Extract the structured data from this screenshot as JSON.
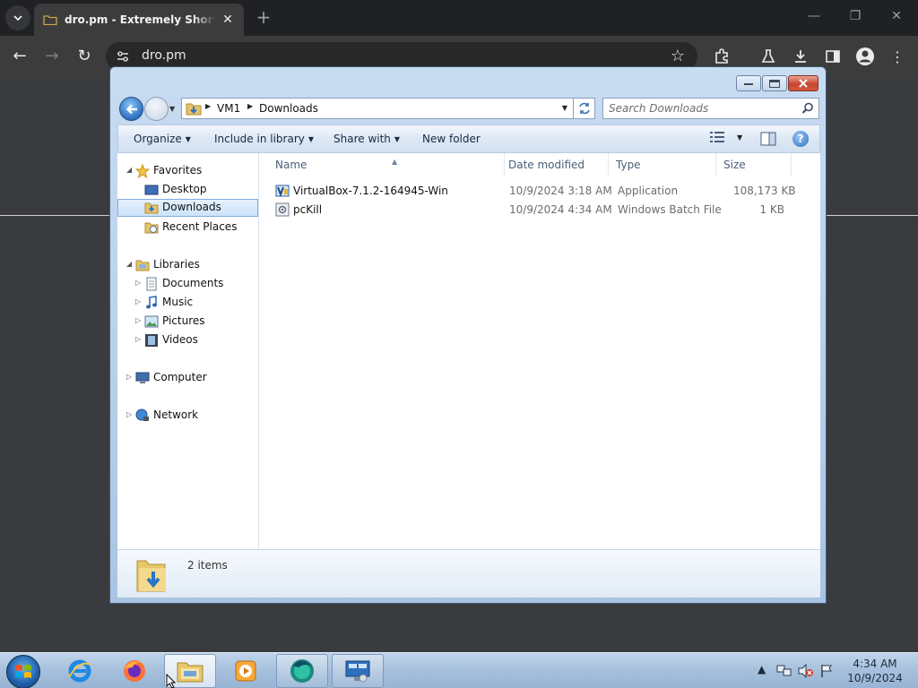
{
  "browser": {
    "tab_title": "dro.pm - Extremely Short Links",
    "url": "dro.pm"
  },
  "explorer": {
    "breadcrumb": [
      "VM1",
      "Downloads"
    ],
    "search_placeholder": "Search Downloads",
    "commands": {
      "organize": "Organize",
      "include_in_library": "Include in library",
      "share_with": "Share with",
      "new_folder": "New folder"
    },
    "nav": {
      "favorites": "Favorites",
      "desktop": "Desktop",
      "downloads": "Downloads",
      "recent_places": "Recent Places",
      "libraries": "Libraries",
      "documents": "Documents",
      "music": "Music",
      "pictures": "Pictures",
      "videos": "Videos",
      "computer": "Computer",
      "network": "Network"
    },
    "columns": {
      "name": "Name",
      "date_modified": "Date modified",
      "type": "Type",
      "size": "Size"
    },
    "files": [
      {
        "name": "VirtualBox-7.1.2-164945-Win",
        "date": "10/9/2024 3:18 AM",
        "type": "Application",
        "size": "108,173 KB"
      },
      {
        "name": "pcKill",
        "date": "10/9/2024 4:34 AM",
        "type": "Windows Batch File",
        "size": "1 KB"
      }
    ],
    "status": "2 items"
  },
  "taskbar": {
    "time": "4:34 AM",
    "date": "10/9/2024"
  }
}
